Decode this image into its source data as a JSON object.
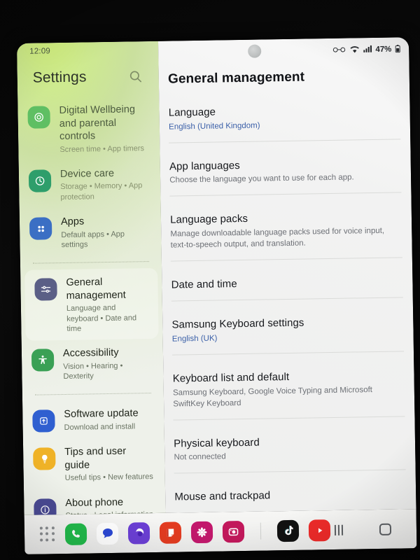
{
  "left_panel": {
    "status_time": "12:09",
    "title": "Settings",
    "search_icon": "search-icon",
    "items": [
      {
        "icon": "digital-wellbeing-icon",
        "icon_color": "#5fbf63",
        "label": "Digital Wellbeing and parental controls",
        "sub": "Screen time  •  App timers",
        "selected": false,
        "faded": true
      },
      {
        "icon": "device-care-icon",
        "icon_color": "#2e9e6b",
        "label": "Device care",
        "sub": "Storage  •  Memory  •  App protection",
        "selected": false,
        "faded": true
      },
      {
        "icon": "apps-icon",
        "icon_color": "#3b6fc4",
        "label": "Apps",
        "sub": "Default apps  •  App settings",
        "selected": false,
        "faded": false
      },
      {
        "icon": "general-management-icon",
        "icon_color": "#5b5f86",
        "label": "General management",
        "sub": "Language and keyboard  •  Date and time",
        "selected": true,
        "faded": false
      },
      {
        "icon": "accessibility-icon",
        "icon_color": "#3aa055",
        "label": "Accessibility",
        "sub": "Vision  •  Hearing  •  Dexterity",
        "selected": false,
        "faded": false
      },
      {
        "icon": "software-update-icon",
        "icon_color": "#2f5fd0",
        "label": "Software update",
        "sub": "Download and install",
        "selected": false,
        "faded": false
      },
      {
        "icon": "tips-icon",
        "icon_color": "#efb227",
        "label": "Tips and user guide",
        "sub": "Useful tips  •  New features",
        "selected": false,
        "faded": false
      },
      {
        "icon": "about-phone-icon",
        "icon_color": "#4a4a93",
        "label": "About phone",
        "sub": "Status  •  Legal information  •  Phone name",
        "selected": false,
        "faded": false
      }
    ],
    "divider_after_indices": [
      2,
      4
    ]
  },
  "right_panel": {
    "status_bar": {
      "glasses_icon": "glasses-icon",
      "wifi_icon": "wifi-icon",
      "signal_icon": "signal-bars-icon",
      "battery_percent": "47%",
      "battery_icon": "battery-icon"
    },
    "title": "General management",
    "items": [
      {
        "label": "Language",
        "sub": "English (United Kingdom)",
        "sub_is_link": true
      },
      {
        "label": "App languages",
        "sub": "Choose the language you want to use for each app.",
        "sub_is_link": false
      },
      {
        "label": "Language packs",
        "sub": "Manage downloadable language packs used for voice input, text-to-speech output, and translation.",
        "sub_is_link": false
      },
      {
        "label": "Date and time",
        "sub": "",
        "sub_is_link": false
      },
      {
        "label": "Samsung Keyboard settings",
        "sub": "English (UK)",
        "sub_is_link": true
      },
      {
        "label": "Keyboard list and default",
        "sub": "Samsung Keyboard, Google Voice Typing and Microsoft SwiftKey Keyboard",
        "sub_is_link": false
      },
      {
        "label": "Physical keyboard",
        "sub": "Not connected",
        "sub_is_link": false
      },
      {
        "label": "Mouse and trackpad",
        "sub": "",
        "sub_is_link": false
      }
    ]
  },
  "taskbar": {
    "apps_button": "apps-grid-icon",
    "apps": [
      {
        "name": "phone-app-icon",
        "color": "#21ba4b",
        "glyph": "phone"
      },
      {
        "name": "messages-app-icon",
        "color": "#ffffff",
        "glyph": "message"
      },
      {
        "name": "internet-app-icon",
        "color": "#6b3fd4",
        "glyph": "browser"
      },
      {
        "name": "notes-app-icon",
        "color": "#e23b20",
        "glyph": "note"
      },
      {
        "name": "flower-app-icon",
        "color": "#c2186c",
        "glyph": "flower"
      },
      {
        "name": "camera-app-icon",
        "color": "#c2185b",
        "glyph": "camera"
      },
      {
        "name": "tiktok-app-icon",
        "color": "#111111",
        "glyph": "tiktok"
      },
      {
        "name": "youtube-app-icon",
        "color": "#ee2b29",
        "glyph": "youtube"
      }
    ],
    "nav": {
      "recents": "recents-button",
      "home": "home-button",
      "back": "back-button"
    }
  },
  "colors": {
    "glare_green": "#d6f674",
    "link_blue": "#3a5fa8",
    "panel_grey": "#f2f2f2"
  }
}
